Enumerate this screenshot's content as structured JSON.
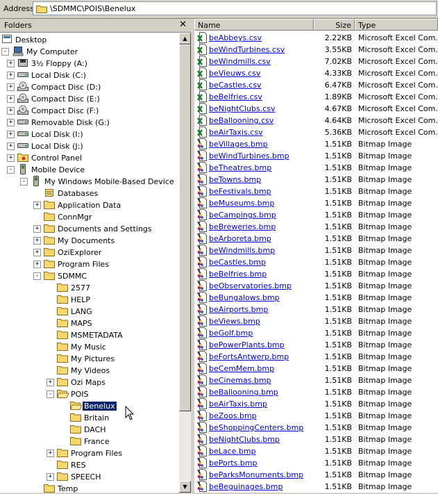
{
  "address": {
    "label": "Address",
    "value": "\\SDMMC\\POIS\\Benelux"
  },
  "folders_pane": {
    "title": "Folders",
    "close_glyph": "✕",
    "tree": [
      {
        "label": "Desktop",
        "icon": "desktop-icon",
        "depth": 0,
        "expander": ""
      },
      {
        "label": "My Computer",
        "icon": "computer-icon",
        "depth": 0,
        "expander": "-"
      },
      {
        "label": "3½ Floppy (A:)",
        "icon": "floppy-icon",
        "depth": 1,
        "expander": "+"
      },
      {
        "label": "Local Disk (C:)",
        "icon": "drive-icon",
        "depth": 1,
        "expander": "+"
      },
      {
        "label": "Compact Disc (D:)",
        "icon": "cd-icon",
        "depth": 1,
        "expander": "+"
      },
      {
        "label": "Compact Disc (E:)",
        "icon": "cd-icon",
        "depth": 1,
        "expander": "+"
      },
      {
        "label": "Compact Disc (F:)",
        "icon": "cd-icon",
        "depth": 1,
        "expander": "+"
      },
      {
        "label": "Removable Disk (G:)",
        "icon": "drive-icon",
        "depth": 1,
        "expander": "+"
      },
      {
        "label": "Local Disk (I:)",
        "icon": "drive-icon",
        "depth": 1,
        "expander": "+"
      },
      {
        "label": "Local Disk (J:)",
        "icon": "drive-icon",
        "depth": 1,
        "expander": "+"
      },
      {
        "label": "Control Panel",
        "icon": "control-panel-icon",
        "depth": 1,
        "expander": "+"
      },
      {
        "label": "Mobile Device",
        "icon": "mobile-device-icon",
        "depth": 1,
        "expander": "-"
      },
      {
        "label": "My Windows Mobile-Based Device",
        "icon": "mobile-device-icon",
        "depth": 2,
        "expander": "-"
      },
      {
        "label": "Databases",
        "icon": "database-icon",
        "depth": 3,
        "expander": ""
      },
      {
        "label": "Application Data",
        "icon": "folder-icon",
        "depth": 3,
        "expander": "+"
      },
      {
        "label": "ConnMgr",
        "icon": "folder-icon",
        "depth": 3,
        "expander": ""
      },
      {
        "label": "Documents and Settings",
        "icon": "folder-icon",
        "depth": 3,
        "expander": "+"
      },
      {
        "label": "My Documents",
        "icon": "folder-icon",
        "depth": 3,
        "expander": "+"
      },
      {
        "label": "OziExplorer",
        "icon": "folder-icon",
        "depth": 3,
        "expander": "+"
      },
      {
        "label": "Program Files",
        "icon": "folder-icon",
        "depth": 3,
        "expander": "+"
      },
      {
        "label": "SDMMC",
        "icon": "folder-icon",
        "depth": 3,
        "expander": "-"
      },
      {
        "label": "2577",
        "icon": "folder-icon",
        "depth": 4,
        "expander": ""
      },
      {
        "label": "HELP",
        "icon": "folder-icon",
        "depth": 4,
        "expander": ""
      },
      {
        "label": "LANG",
        "icon": "folder-icon",
        "depth": 4,
        "expander": ""
      },
      {
        "label": "MAPS",
        "icon": "folder-icon",
        "depth": 4,
        "expander": ""
      },
      {
        "label": "MSMETADATA",
        "icon": "folder-icon",
        "depth": 4,
        "expander": ""
      },
      {
        "label": "My Music",
        "icon": "folder-icon",
        "depth": 4,
        "expander": ""
      },
      {
        "label": "My Pictures",
        "icon": "folder-icon",
        "depth": 4,
        "expander": ""
      },
      {
        "label": "My Videos",
        "icon": "folder-icon",
        "depth": 4,
        "expander": ""
      },
      {
        "label": "Ozi Maps",
        "icon": "folder-icon",
        "depth": 4,
        "expander": "+"
      },
      {
        "label": "POIS",
        "icon": "folder-open-icon",
        "depth": 4,
        "expander": "-"
      },
      {
        "label": "Benelux",
        "icon": "folder-open-icon",
        "depth": 5,
        "expander": "",
        "selected": true
      },
      {
        "label": "Britain",
        "icon": "folder-icon",
        "depth": 5,
        "expander": ""
      },
      {
        "label": "DACH",
        "icon": "folder-icon",
        "depth": 5,
        "expander": ""
      },
      {
        "label": "France",
        "icon": "folder-icon",
        "depth": 5,
        "expander": ""
      },
      {
        "label": "Program Files",
        "icon": "folder-icon",
        "depth": 4,
        "expander": "+"
      },
      {
        "label": "RES",
        "icon": "folder-icon",
        "depth": 4,
        "expander": ""
      },
      {
        "label": "SPEECH",
        "icon": "folder-icon",
        "depth": 4,
        "expander": "+"
      },
      {
        "label": "Temp",
        "icon": "folder-icon",
        "depth": 3,
        "expander": ""
      }
    ]
  },
  "columns": {
    "name": "Name",
    "size": "Size",
    "type": "Type"
  },
  "files": [
    {
      "name": "beAbbeys.csv",
      "size": "2.22KB",
      "type": "Microsoft Excel Com...",
      "icon": "excel-csv-icon"
    },
    {
      "name": "beWindTurbines.csv",
      "size": "3.55KB",
      "type": "Microsoft Excel Com...",
      "icon": "excel-csv-icon"
    },
    {
      "name": "beWindmills.csv",
      "size": "7.02KB",
      "type": "Microsoft Excel Com...",
      "icon": "excel-csv-icon"
    },
    {
      "name": "beVieuws.csv",
      "size": "4.33KB",
      "type": "Microsoft Excel Com...",
      "icon": "excel-csv-icon"
    },
    {
      "name": "beCastles.csv",
      "size": "6.47KB",
      "type": "Microsoft Excel Com...",
      "icon": "excel-csv-icon"
    },
    {
      "name": "beBelfries.csv",
      "size": "1.89KB",
      "type": "Microsoft Excel Com...",
      "icon": "excel-csv-icon"
    },
    {
      "name": "beNightClubs.csv",
      "size": "4.67KB",
      "type": "Microsoft Excel Com...",
      "icon": "excel-csv-icon"
    },
    {
      "name": "beBallooning.csv",
      "size": "4.64KB",
      "type": "Microsoft Excel Com...",
      "icon": "excel-csv-icon"
    },
    {
      "name": "beAirTaxis.csv",
      "size": "5.36KB",
      "type": "Microsoft Excel Com...",
      "icon": "excel-csv-icon"
    },
    {
      "name": "beVillages.bmp",
      "size": "1.51KB",
      "type": "Bitmap Image",
      "icon": "bitmap-icon"
    },
    {
      "name": "beWindTurbines.bmp",
      "size": "1.51KB",
      "type": "Bitmap Image",
      "icon": "bitmap-icon"
    },
    {
      "name": "beTheatres.bmp",
      "size": "1.51KB",
      "type": "Bitmap Image",
      "icon": "bitmap-icon"
    },
    {
      "name": "beTowns.bmp",
      "size": "1.51KB",
      "type": "Bitmap Image",
      "icon": "bitmap-icon"
    },
    {
      "name": "beFestivals.bmp",
      "size": "1.51KB",
      "type": "Bitmap Image",
      "icon": "bitmap-icon"
    },
    {
      "name": "beMuseums.bmp",
      "size": "1.51KB",
      "type": "Bitmap Image",
      "icon": "bitmap-icon"
    },
    {
      "name": "beCampings.bmp",
      "size": "1.51KB",
      "type": "Bitmap Image",
      "icon": "bitmap-icon"
    },
    {
      "name": "beBreweries.bmp",
      "size": "1.51KB",
      "type": "Bitmap Image",
      "icon": "bitmap-icon"
    },
    {
      "name": "beArboreta.bmp",
      "size": "1.51KB",
      "type": "Bitmap Image",
      "icon": "bitmap-icon"
    },
    {
      "name": "beWindmills.bmp",
      "size": "1.51KB",
      "type": "Bitmap Image",
      "icon": "bitmap-icon"
    },
    {
      "name": "beCastles.bmp",
      "size": "1.51KB",
      "type": "Bitmap Image",
      "icon": "bitmap-icon"
    },
    {
      "name": "beBelfries.bmp",
      "size": "1.51KB",
      "type": "Bitmap Image",
      "icon": "bitmap-icon"
    },
    {
      "name": "beObservatories.bmp",
      "size": "1.51KB",
      "type": "Bitmap Image",
      "icon": "bitmap-icon"
    },
    {
      "name": "beBungalows.bmp",
      "size": "1.51KB",
      "type": "Bitmap Image",
      "icon": "bitmap-icon"
    },
    {
      "name": "beAirports.bmp",
      "size": "1.51KB",
      "type": "Bitmap Image",
      "icon": "bitmap-icon"
    },
    {
      "name": "beViews.bmp",
      "size": "1.51KB",
      "type": "Bitmap Image",
      "icon": "bitmap-icon"
    },
    {
      "name": "beGolf.bmp",
      "size": "1.51KB",
      "type": "Bitmap Image",
      "icon": "bitmap-icon"
    },
    {
      "name": "bePowerPlants.bmp",
      "size": "1.51KB",
      "type": "Bitmap Image",
      "icon": "bitmap-icon"
    },
    {
      "name": "beFortsAntwerp.bmp",
      "size": "1.51KB",
      "type": "Bitmap Image",
      "icon": "bitmap-icon"
    },
    {
      "name": "beCemMem.bmp",
      "size": "1.51KB",
      "type": "Bitmap Image",
      "icon": "bitmap-icon"
    },
    {
      "name": "beCinemas.bmp",
      "size": "1.51KB",
      "type": "Bitmap Image",
      "icon": "bitmap-icon"
    },
    {
      "name": "beBallooning.bmp",
      "size": "1.51KB",
      "type": "Bitmap Image",
      "icon": "bitmap-icon"
    },
    {
      "name": "beAirTaxis.bmp",
      "size": "1.51KB",
      "type": "Bitmap Image",
      "icon": "bitmap-icon"
    },
    {
      "name": "beZoos.bmp",
      "size": "1.51KB",
      "type": "Bitmap Image",
      "icon": "bitmap-icon"
    },
    {
      "name": "beShoppingCenters.bmp",
      "size": "1.51KB",
      "type": "Bitmap Image",
      "icon": "bitmap-icon"
    },
    {
      "name": "beNightClubs.bmp",
      "size": "1.51KB",
      "type": "Bitmap Image",
      "icon": "bitmap-icon"
    },
    {
      "name": "beLace.bmp",
      "size": "1.51KB",
      "type": "Bitmap Image",
      "icon": "bitmap-icon"
    },
    {
      "name": "bePorts.bmp",
      "size": "1.51KB",
      "type": "Bitmap Image",
      "icon": "bitmap-icon"
    },
    {
      "name": "beParksMonuments.bmp",
      "size": "1.51KB",
      "type": "Bitmap Image",
      "icon": "bitmap-icon"
    },
    {
      "name": "beBeguinages.bmp",
      "size": "1.51KB",
      "type": "Bitmap Image",
      "icon": "bitmap-icon"
    }
  ],
  "colors": {
    "link": "#0000cc",
    "selection_bg": "#0a246a",
    "chrome": "#d4d0c8",
    "folder_yellow": "#f5d76e"
  }
}
